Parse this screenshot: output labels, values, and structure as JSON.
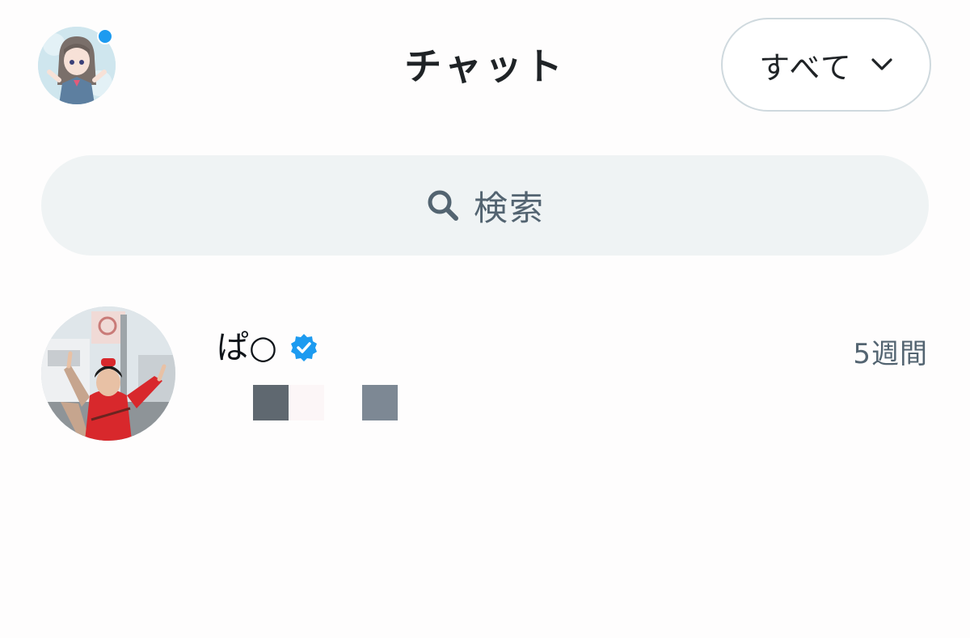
{
  "header": {
    "title": "チャット",
    "filter_label": "すべて",
    "notification_color": "#1d9bf0"
  },
  "search": {
    "placeholder": "検索",
    "icon": "search-icon"
  },
  "conversations": [
    {
      "name": "ぱ○",
      "verified": true,
      "time": "5週間",
      "preview_redacted": true
    }
  ],
  "colors": {
    "accent": "#1d9bf0",
    "muted_text": "#536471",
    "search_bg": "#eff3f4",
    "border": "#cfd9de"
  }
}
